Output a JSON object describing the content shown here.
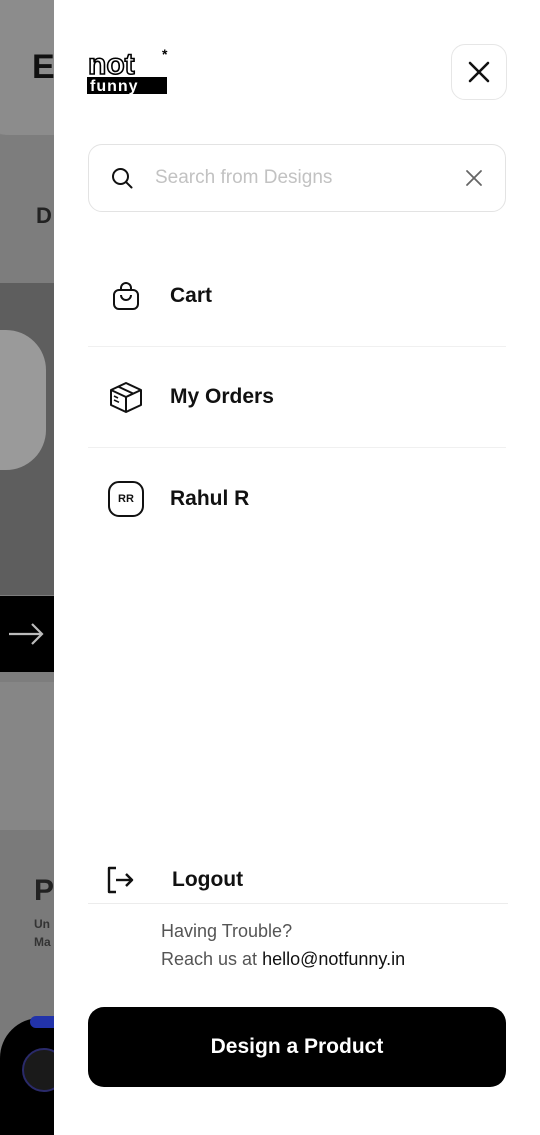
{
  "background": {
    "title_letter": "E",
    "sub_letter": "D",
    "low_letter": "P",
    "low_text_1": "Un",
    "low_text_2": "Ma"
  },
  "drawer": {
    "brand": {
      "logo_top": "not",
      "logo_bottom": "funny",
      "logo_mark": "*"
    },
    "close_icon": "close-icon",
    "search": {
      "placeholder": "Search from Designs",
      "value": "",
      "icon": "search-icon",
      "clear_icon": "close-icon"
    },
    "menu": [
      {
        "label": "Cart",
        "icon": "shopping-bag-icon"
      },
      {
        "label": "My Orders",
        "icon": "package-box-icon"
      },
      {
        "label": "Rahul R",
        "icon": "user-avatar",
        "initials": "RR"
      }
    ],
    "logout": {
      "label": "Logout",
      "icon": "logout-icon"
    },
    "help": {
      "line1": "Having Trouble?",
      "line2_prefix": "Reach us at ",
      "email": "hello@notfunny.in"
    },
    "cta": {
      "label": "Design a Product"
    }
  },
  "colors": {
    "primary": "#000000",
    "background": "#ffffff",
    "overlay": "#7d7d7d",
    "placeholder": "#c2c2c2"
  }
}
